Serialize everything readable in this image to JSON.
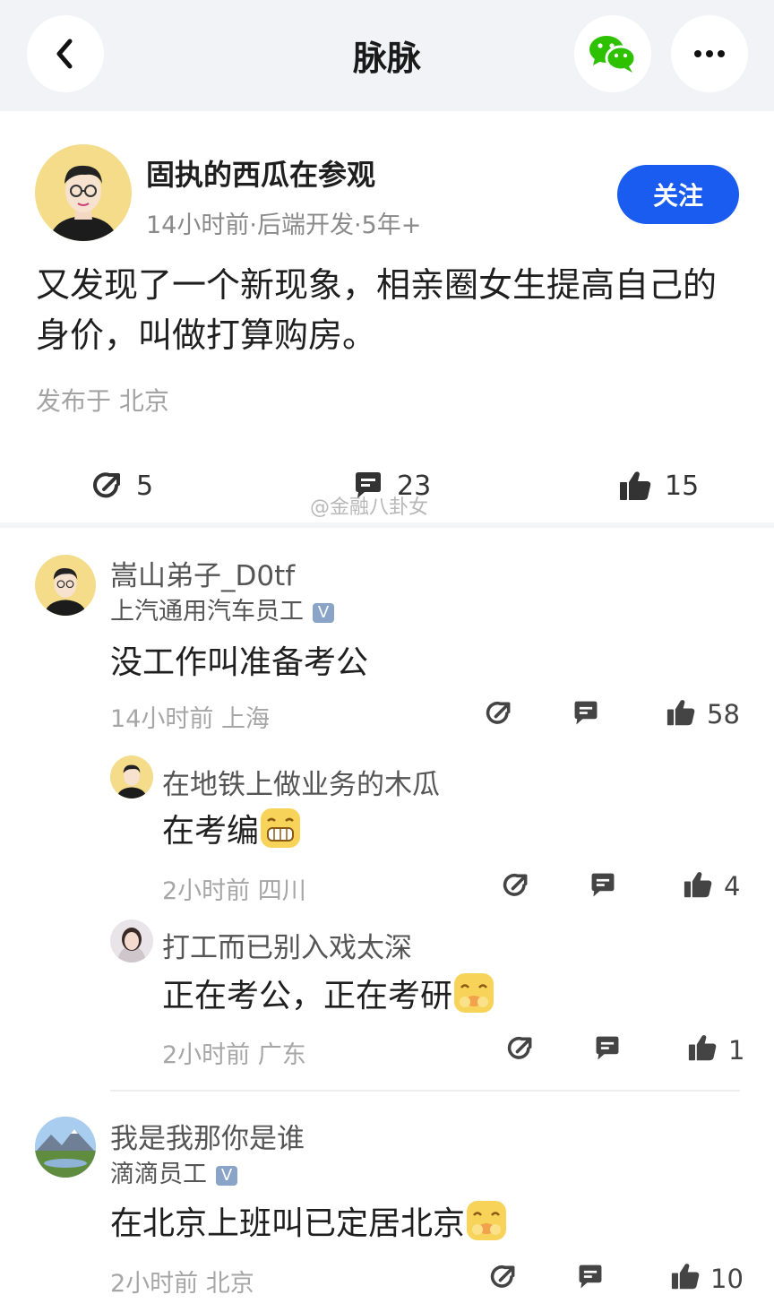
{
  "header": {
    "title": "脉脉",
    "back_icon": "chevron-left-icon",
    "share_icon": "wechat-icon",
    "more_icon": "more-horizontal-icon"
  },
  "post": {
    "author": "固执的西瓜在参观",
    "meta": "14小时前·后端开发·5年+",
    "follow_label": "关注",
    "text": "又发现了一个新现象，相亲圈女生提高自己的身价，叫做打算购房。",
    "location": "发布于 北京",
    "share_count": "5",
    "comment_count": "23",
    "like_count": "15",
    "watermark": "@金融八卦女"
  },
  "comments": [
    {
      "name": "嵩山弟子_D0tf",
      "company": "上汽通用汽车员工",
      "text": "没工作叫准备考公",
      "meta": "14小时前  上海",
      "likes": "58"
    },
    {
      "name": "在地铁上做业务的木瓜",
      "text": "在考编",
      "meta": "2小时前  四川",
      "likes": "4"
    },
    {
      "name": "打工而已别入戏太深",
      "text": "正在考公，正在考研",
      "meta": "2小时前  广东",
      "likes": "1"
    },
    {
      "name": "我是我那你是谁",
      "company": "滴滴员工",
      "text": "在北京上班叫已定居北京",
      "meta": "2小时前  北京",
      "likes": "10"
    }
  ],
  "colors": {
    "accent": "#1a5cf0",
    "wechat": "#2dc100",
    "badge": "#8aa4c8"
  }
}
